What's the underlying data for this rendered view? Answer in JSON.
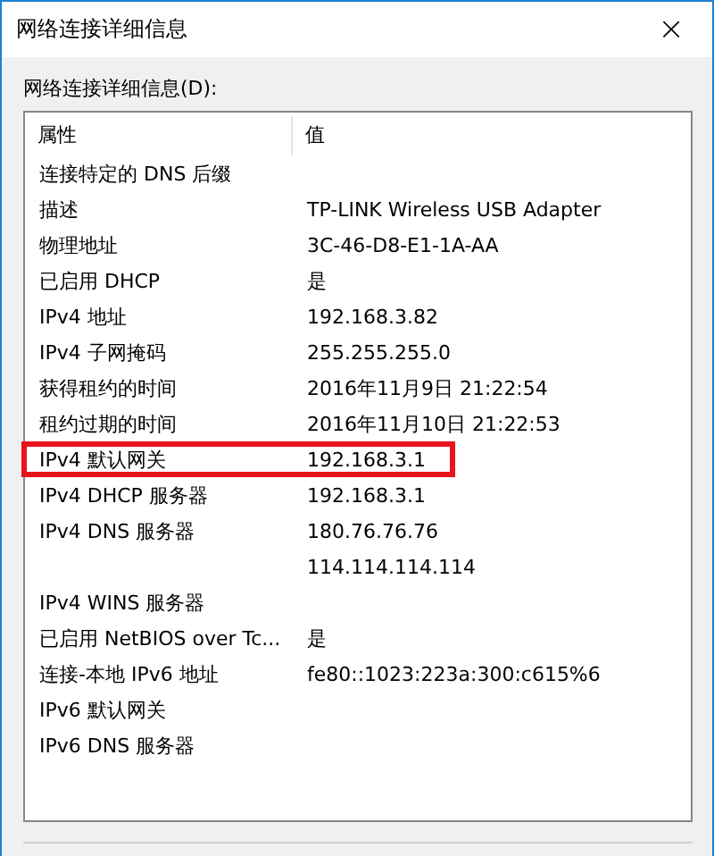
{
  "window": {
    "title": "网络连接详细信息",
    "close": "×"
  },
  "list_label": "网络连接详细信息(D):",
  "columns": [
    "属性",
    "值"
  ],
  "rows": [
    {
      "property": "连接特定的 DNS 后缀",
      "value": "",
      "highlighted": false
    },
    {
      "property": "描述",
      "value": "TP-LINK Wireless USB Adapter",
      "highlighted": false
    },
    {
      "property": "物理地址",
      "value": "3C-46-D8-E1-1A-AA",
      "highlighted": false
    },
    {
      "property": "已启用 DHCP",
      "value": "是",
      "highlighted": false
    },
    {
      "property": "IPv4 地址",
      "value": "192.168.3.82",
      "highlighted": false
    },
    {
      "property": "IPv4 子网掩码",
      "value": "255.255.255.0",
      "highlighted": false
    },
    {
      "property": "获得租约的时间",
      "value": "2016年11月9日 21:22:54",
      "highlighted": false
    },
    {
      "property": "租约过期的时间",
      "value": "2016年11月10日 21:22:53",
      "highlighted": false
    },
    {
      "property": "IPv4 默认网关",
      "value": "192.168.3.1",
      "highlighted": true
    },
    {
      "property": "IPv4 DHCP 服务器",
      "value": "192.168.3.1",
      "highlighted": false
    },
    {
      "property": "IPv4 DNS 服务器",
      "value": "180.76.76.76",
      "highlighted": false
    },
    {
      "property": "",
      "value": "114.114.114.114",
      "highlighted": false
    },
    {
      "property": "IPv4 WINS 服务器",
      "value": "",
      "highlighted": false
    },
    {
      "property": "已启用 NetBIOS over Tc...",
      "value": "是",
      "highlighted": false
    },
    {
      "property": "连接-本地 IPv6 地址",
      "value": "fe80::1023:223a:300:c615%6",
      "highlighted": false
    },
    {
      "property": "IPv6 默认网关",
      "value": "",
      "highlighted": false
    },
    {
      "property": "IPv6 DNS 服务器",
      "value": "",
      "highlighted": false
    }
  ]
}
